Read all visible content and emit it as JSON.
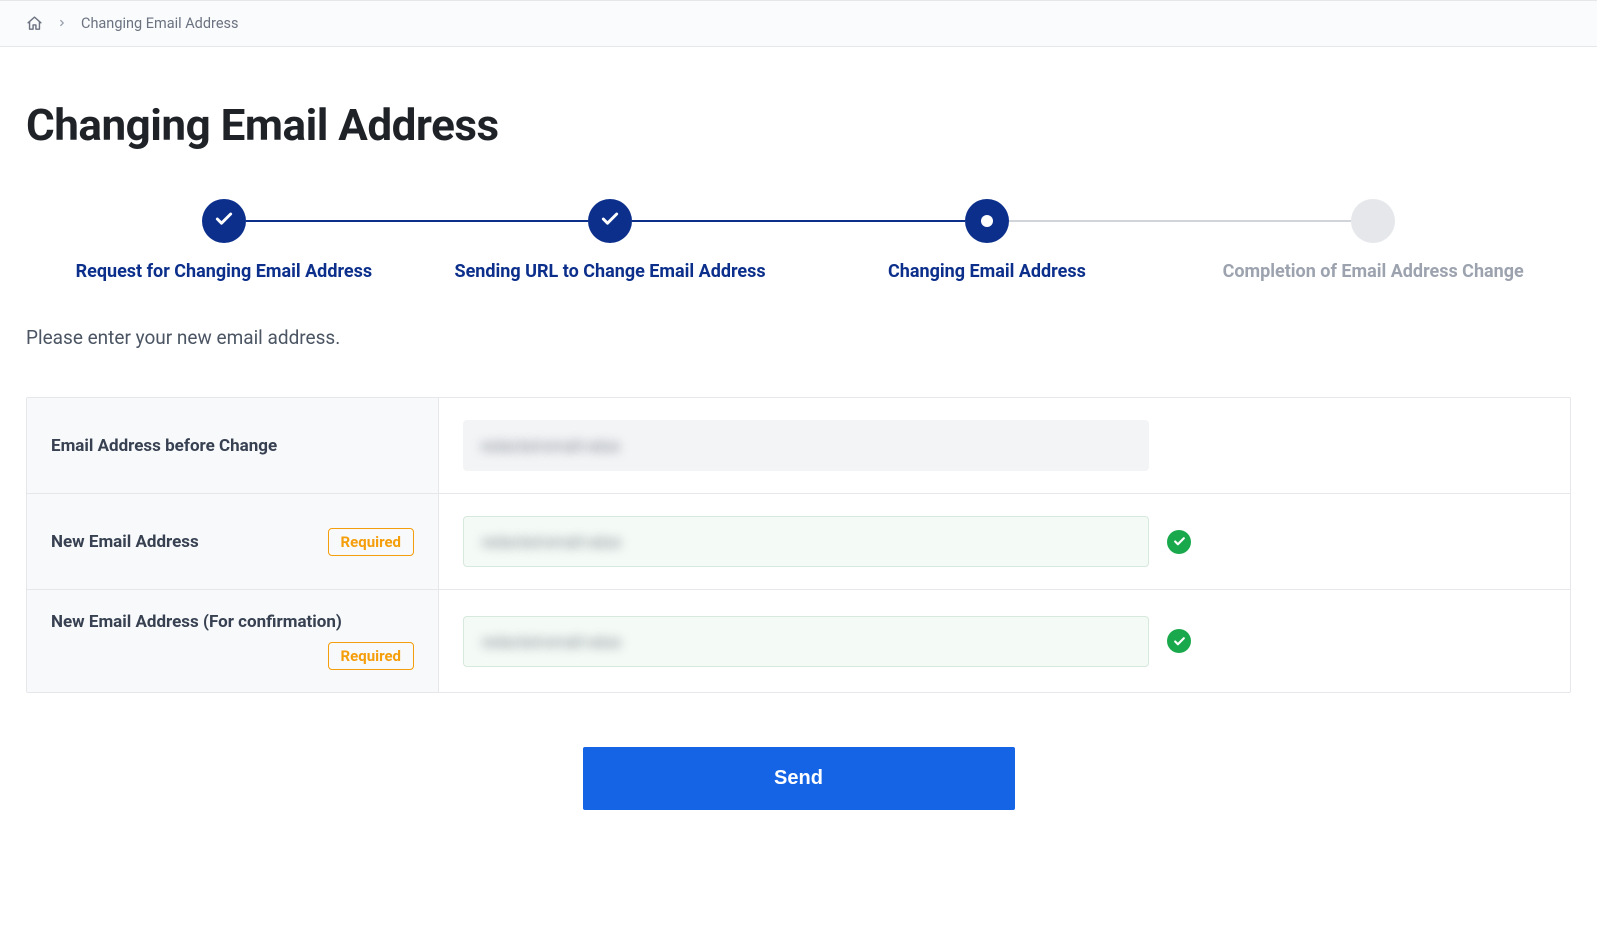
{
  "breadcrumb": {
    "current": "Changing Email Address"
  },
  "page": {
    "title": "Changing Email Address",
    "instruction": "Please enter your new email address."
  },
  "stepper": {
    "steps": [
      {
        "label": "Request for Changing Email Address",
        "state": "done"
      },
      {
        "label": "Sending URL to Change Email Address",
        "state": "done"
      },
      {
        "label": "Changing Email Address",
        "state": "current"
      },
      {
        "label": "Completion of Email Address Change",
        "state": "future"
      }
    ]
  },
  "form": {
    "required_label": "Required",
    "rows": {
      "before": {
        "label": "Email Address before Change",
        "value": "redacted-email-value"
      },
      "new": {
        "label": "New Email Address",
        "value": "redacted-email-value",
        "valid": true
      },
      "confirm": {
        "label": "New Email Address (For confirmation)",
        "value": "redacted-email-value",
        "valid": true
      }
    }
  },
  "actions": {
    "send": "Send"
  }
}
